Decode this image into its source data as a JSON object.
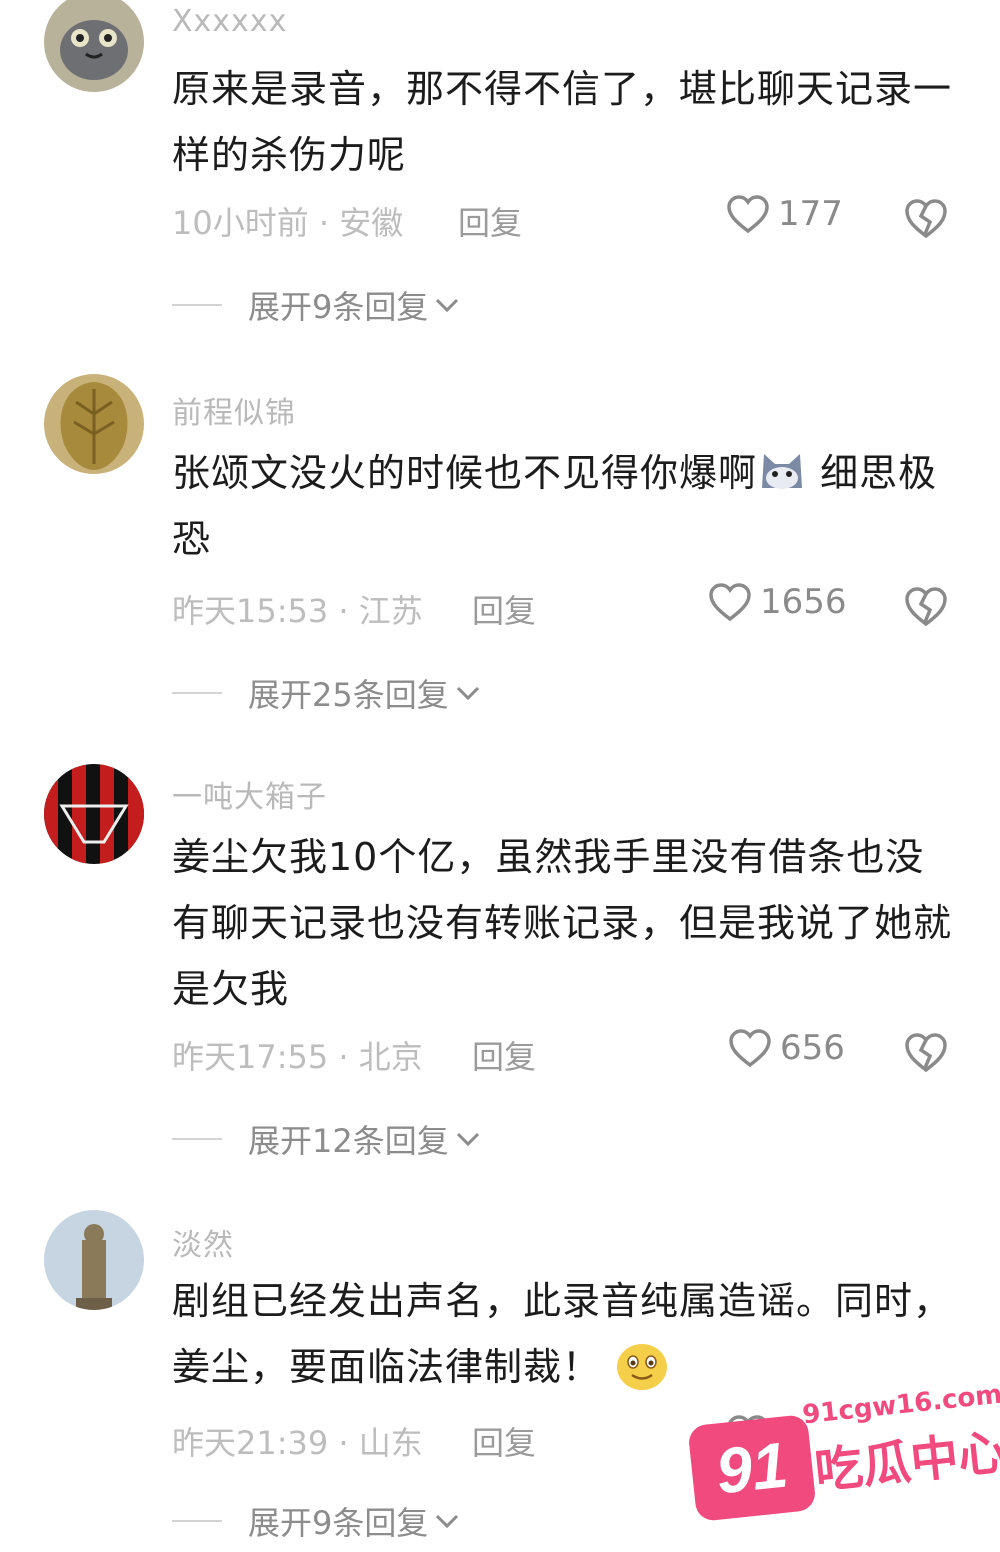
{
  "comments": [
    {
      "username": "Xxxxxx",
      "content": "原来是录音，那不得不信了，堪比聊天记录一样的杀伤力呢",
      "time_location": "10小时前 · 安徽",
      "reply_label": "回复",
      "likes": "177",
      "expand_label": "展开9条回复"
    },
    {
      "username": "前程似锦",
      "content_before_emoji": "张颂文没火的时候也不见得你爆啊",
      "content_after_emoji": " 细思极恐",
      "time_location": "昨天15:53 · 江苏",
      "reply_label": "回复",
      "likes": "1656",
      "expand_label": "展开25条回复"
    },
    {
      "username": "一吨大箱子",
      "content": "姜尘欠我10个亿，虽然我手里没有借条也没有聊天记录也没有转账记录，但是我说了她就是欠我",
      "time_location": "昨天17:55 · 北京",
      "reply_label": "回复",
      "likes": "656",
      "expand_label": "展开12条回复"
    },
    {
      "username": "淡然",
      "content": "剧组已经发出声名，此录音纯属造谣。同时，姜尘，要面临法律制裁！",
      "time_location": "昨天21:39 · 山东",
      "reply_label": "回复",
      "expand_label": "展开9条回复"
    }
  ],
  "icons": {
    "like": "heart-outline-icon",
    "dislike": "broken-heart-icon",
    "expand": "chevron-down-icon"
  },
  "watermark": {
    "badge": "91",
    "url": "91cgw16.com",
    "text": "吃瓜中心",
    "color": "#f04a7e"
  }
}
